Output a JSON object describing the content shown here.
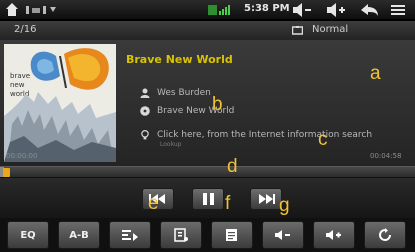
{
  "status_bar": {
    "clock": "5:38 PM",
    "icons": [
      "home-icon",
      "notification-icons",
      "signal-icon",
      "volume-down-icon",
      "volume-up-icon",
      "back-icon",
      "menu-icon"
    ]
  },
  "info_row": {
    "track_count": "2/16",
    "eq_mode": "Normal"
  },
  "track": {
    "title": "Brave New World",
    "artist": "Wes Burden",
    "album": "Brave New World",
    "search_prompt": "Click here, from the Internet information search",
    "hint": "Lookup",
    "elapsed": "00:00:00",
    "total": "00:04:58"
  },
  "progress": {
    "fraction": 0.01
  },
  "transport": {
    "prev": "previous-icon",
    "play_pause": "pause-icon",
    "next": "next-icon"
  },
  "toolbar": {
    "eq_label": "EQ",
    "ab_label": "A-B",
    "buttons": [
      "EQ",
      "A-B",
      "playmode-icon",
      "playlist-icon",
      "lyrics-icon",
      "volume-down-icon",
      "volume-up-icon",
      "return-icon"
    ]
  },
  "annotations": {
    "a": "a",
    "b": "b",
    "c": "c",
    "d": "d",
    "e": "e",
    "f": "f",
    "g": "g"
  },
  "colors": {
    "title": "#d8c400",
    "annotation": "#f1c232",
    "progress_knob": "#e8a81a"
  }
}
